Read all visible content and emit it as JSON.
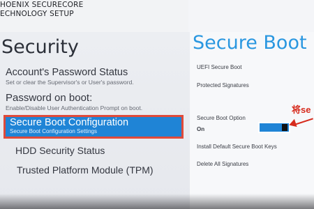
{
  "vendor": {
    "line1": "HOENIX SECURECORE",
    "line2": "ECHNOLOGY SETUP"
  },
  "left": {
    "title": "Security",
    "items": [
      {
        "label": "Account's Password Status",
        "desc": "Set or clear the Supervisor's or User's password."
      },
      {
        "label": "Password on boot:",
        "desc": "Enable/Disable User Authentication Prompt on boot."
      },
      {
        "label": "Secure Boot Configuration",
        "desc": "Secure Boot Configuration Settings"
      },
      {
        "label": "HDD Security Status"
      },
      {
        "label": "Trusted Platform Module (TPM)"
      }
    ]
  },
  "right": {
    "title": "Secure Boot",
    "uefi_secure_boot": "UEFI Secure Boot",
    "protected_signatures": "Protected Signatures",
    "secure_boot_option_label": "Secure Boot Option",
    "secure_boot_option_value": "On",
    "install_default_keys": "Install Default Secure Boot Keys",
    "delete_all_signatures": "Delete All Signatures"
  },
  "annotation": {
    "text": "将se",
    "color": "#d62a1c"
  },
  "colors": {
    "accent": "#1f84d6",
    "title_blue": "#2a97e0",
    "highlight_border": "#e04a3a"
  }
}
